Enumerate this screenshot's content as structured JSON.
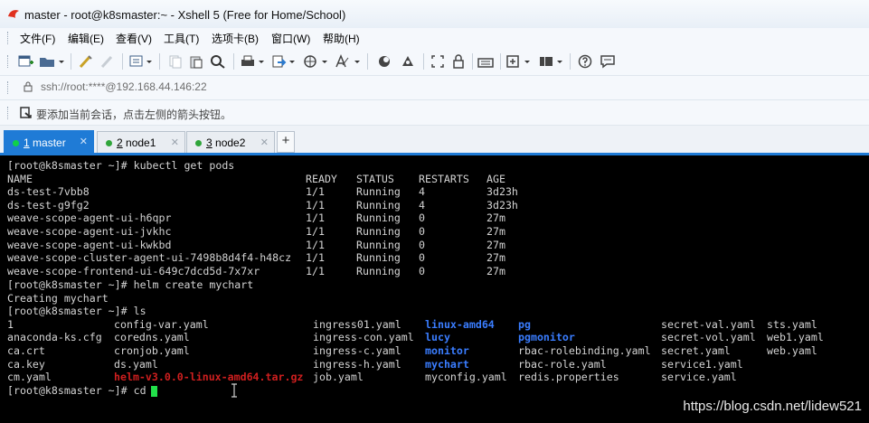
{
  "window": {
    "title": "master - root@k8smaster:~ - Xshell 5 (Free for Home/School)"
  },
  "menu": [
    "文件(F)",
    "编辑(E)",
    "查看(V)",
    "工具(T)",
    "选项卡(B)",
    "窗口(W)",
    "帮助(H)"
  ],
  "toolbar": {
    "icons": [
      "new-session-icon",
      "open-folder-icon",
      "properties-icon",
      "reconnect-icon",
      "transfer-icon",
      "copy-icon",
      "paste-icon",
      "find-icon",
      "print-icon",
      "sftp-icon",
      "globe-icon",
      "font-icon",
      "script-icon",
      "record-icon",
      "fullscreen-icon",
      "lock-icon",
      "keyboard-icon",
      "compose-icon",
      "layout-icon",
      "help-icon",
      "chat-icon"
    ]
  },
  "address": {
    "value": "ssh://root:****@192.168.44.146:22"
  },
  "hint": {
    "text": "要添加当前会话，点击左侧的箭头按钮。"
  },
  "tabs": [
    {
      "num": "1",
      "name": "master",
      "active": true
    },
    {
      "num": "2",
      "name": "node1",
      "active": false
    },
    {
      "num": "3",
      "name": "node2",
      "active": false
    }
  ],
  "tabs_add_label": "+",
  "terminal": {
    "cmd1": "[root@k8smaster ~]# kubectl get pods",
    "headers": [
      "NAME",
      "READY",
      "STATUS",
      "RESTARTS",
      "AGE"
    ],
    "pods": [
      [
        "ds-test-7vbb8",
        "1/1",
        "Running",
        "4",
        "3d23h"
      ],
      [
        "ds-test-g9fg2",
        "1/1",
        "Running",
        "4",
        "3d23h"
      ],
      [
        "weave-scope-agent-ui-h6qpr",
        "1/1",
        "Running",
        "0",
        "27m"
      ],
      [
        "weave-scope-agent-ui-jvkhc",
        "1/1",
        "Running",
        "0",
        "27m"
      ],
      [
        "weave-scope-agent-ui-kwkbd",
        "1/1",
        "Running",
        "0",
        "27m"
      ],
      [
        "weave-scope-cluster-agent-ui-7498b8d4f4-h48cz",
        "1/1",
        "Running",
        "0",
        "27m"
      ],
      [
        "weave-scope-frontend-ui-649c7dcd5d-7x7xr",
        "1/1",
        "Running",
        "0",
        "27m"
      ]
    ],
    "cmd2": "[root@k8smaster ~]# helm create mychart",
    "out2": "Creating mychart",
    "cmd3": "[root@k8smaster ~]# ls",
    "ls_rows": [
      [
        "1",
        "config-var.yaml",
        "ingress01.yaml",
        "linux-amd64",
        "pg",
        "secret-val.yaml",
        "sts.yaml"
      ],
      [
        "anaconda-ks.cfg",
        "coredns.yaml",
        "ingress-con.yaml",
        "lucy",
        "pgmonitor",
        "secret-vol.yaml",
        "web1.yaml"
      ],
      [
        "ca.crt",
        "cronjob.yaml",
        "ingress-c.yaml",
        "monitor",
        "rbac-rolebinding.yaml",
        "secret.yaml",
        "web.yaml"
      ],
      [
        "ca.key",
        "ds.yaml",
        "ingress-h.yaml",
        "mychart",
        "rbac-role.yaml",
        "service1.yaml",
        ""
      ],
      [
        "cm.yaml",
        "helm-v3.0.0-linux-amd64.tar.gz",
        "job.yaml",
        "myconfig.yaml",
        "redis.properties",
        "service.yaml",
        ""
      ]
    ],
    "ls_types": [
      [
        "f",
        "f",
        "f",
        "d",
        "d",
        "f",
        "f"
      ],
      [
        "f",
        "f",
        "f",
        "d",
        "d",
        "f",
        "f"
      ],
      [
        "f",
        "f",
        "f",
        "d",
        "f",
        "f",
        "f"
      ],
      [
        "f",
        "f",
        "f",
        "d",
        "f",
        "f",
        "f"
      ],
      [
        "f",
        "a",
        "f",
        "f",
        "f",
        "f",
        "f"
      ]
    ],
    "cmd4": "[root@k8smaster ~]# cd "
  },
  "colors": {
    "directory": "#3a7dff",
    "archive": "#d01f1f",
    "cursor": "#22e04a",
    "tab_active": "#1f7bd6"
  },
  "watermark": "https://blog.csdn.net/lidew521"
}
